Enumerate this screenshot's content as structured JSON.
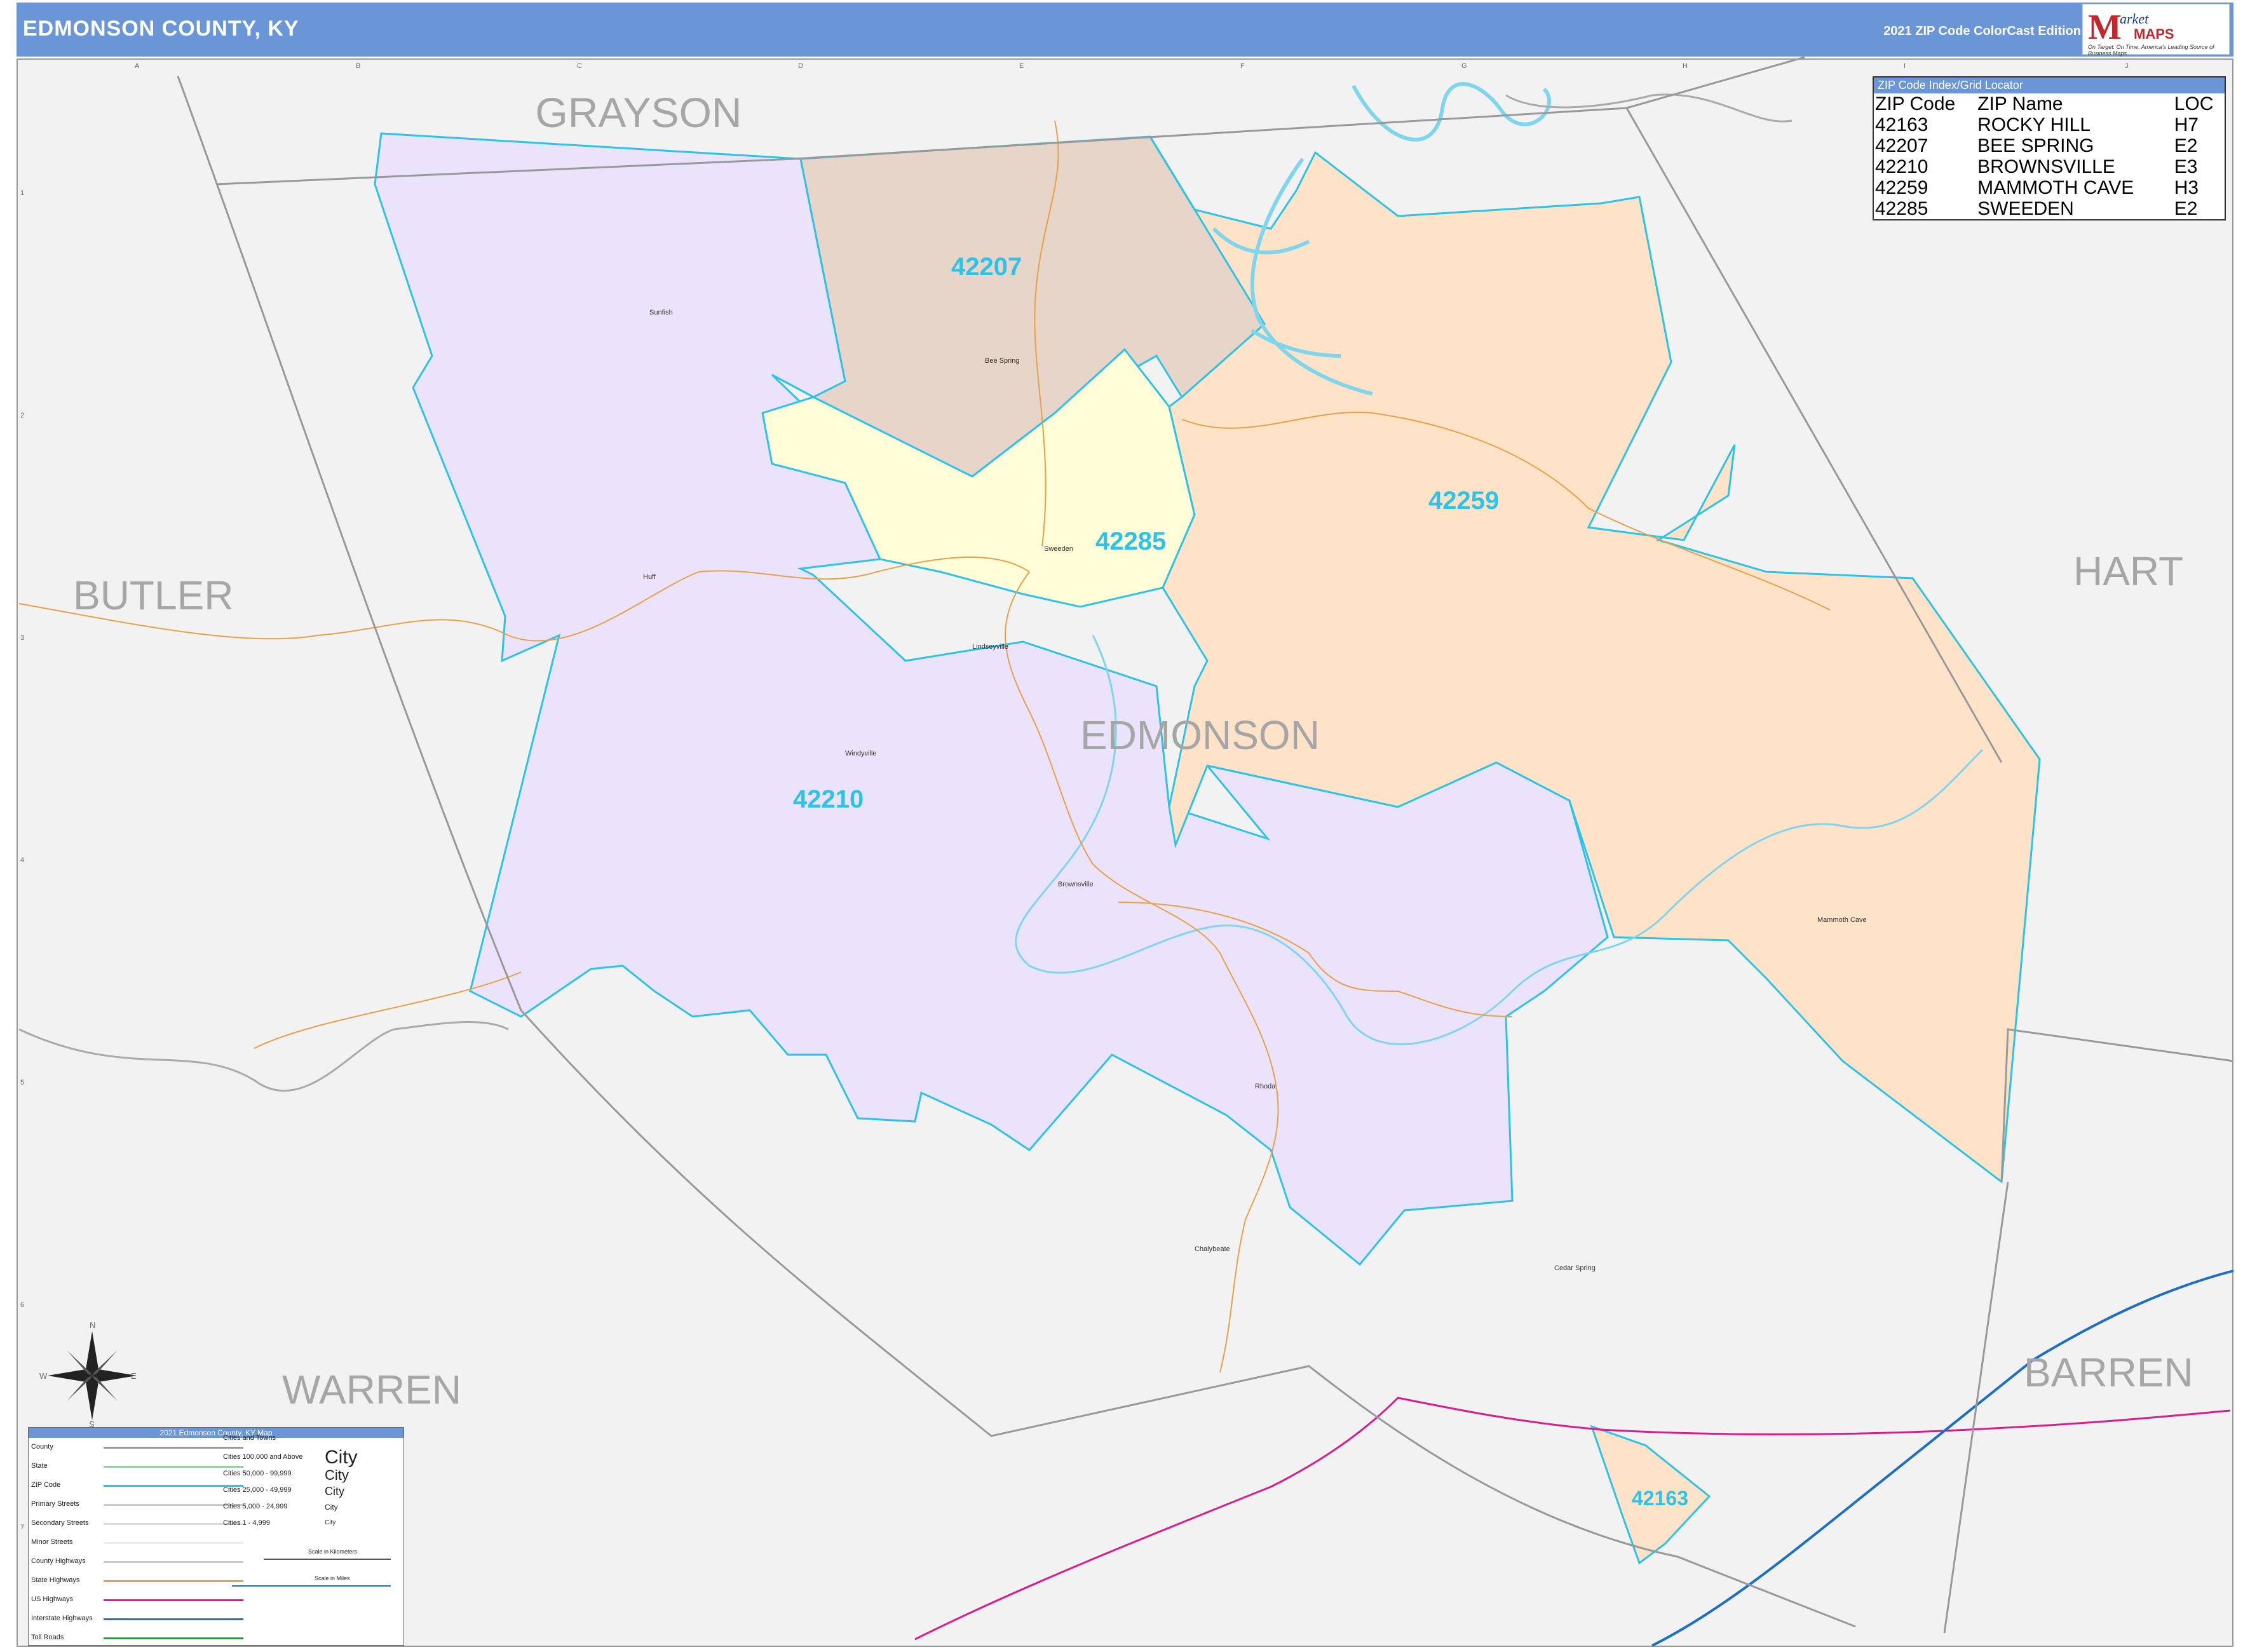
{
  "header": {
    "title": "EDMONSON COUNTY, KY",
    "edition": "2021 ZIP Code ColorCast Edition"
  },
  "logo": {
    "m": "M",
    "arket": "arket",
    "maps": "MAPS",
    "tagline1": "On Target. On Time.",
    "tagline2": "America's Leading Source of Business Maps"
  },
  "colors": {
    "header": "#6a96d8",
    "zip_border": "#2cc3e6",
    "zip_42210": "#ebe3fb",
    "zip_42207": "#e6d5c8",
    "zip_42285": "#fffed8",
    "zip_42259": "#fee3c9",
    "zip_42163": "#fee3c9",
    "water": "#7fd6ec",
    "state_highway": "#e8a04a",
    "us_highway": "#d61e8c",
    "interstate": "#1d6fc4"
  },
  "map": {
    "counties": [
      "GRAYSON",
      "BUTLER",
      "EDMONSON",
      "HART",
      "WARREN",
      "BARREN"
    ],
    "zip_labels": [
      "42207",
      "42285",
      "42259",
      "42210",
      "42163"
    ],
    "towns": [
      "Sunfish",
      "Bee Spring",
      "Sweeden",
      "Huff",
      "Lindseyville",
      "Windyville",
      "Brownsville",
      "Rhoda",
      "Chalybeate",
      "Cedar Spring",
      "Mammoth Cave"
    ],
    "grid_columns": [
      "A",
      "B",
      "C",
      "D",
      "E",
      "F",
      "G",
      "H",
      "I",
      "J"
    ],
    "grid_rows": [
      "1",
      "2",
      "3",
      "4",
      "5",
      "6",
      "7"
    ],
    "compass": [
      "N",
      "E",
      "S",
      "W"
    ]
  },
  "zip_index": {
    "title": "ZIP Code Index/Grid Locator",
    "headers": [
      "ZIP Code",
      "ZIP Name",
      "LOC"
    ],
    "rows": [
      [
        "42163",
        "ROCKY HILL",
        "H7"
      ],
      [
        "42207",
        "BEE SPRING",
        "E2"
      ],
      [
        "42210",
        "BROWNSVILLE",
        "E3"
      ],
      [
        "42259",
        "MAMMOTH CAVE",
        "H3"
      ],
      [
        "42285",
        "SWEEDEN",
        "E2"
      ]
    ]
  },
  "legend": {
    "title": "2021 Edmonson County, KY Map",
    "items": [
      "County",
      "State",
      "ZIP Code",
      "Primary Streets",
      "Secondary Streets",
      "Minor Streets",
      "County Highways",
      "State Highways",
      "US Highways",
      "Interstate Highways",
      "Toll Roads"
    ],
    "cities_title": "Cities and Towns",
    "cities": [
      "Cities 100,000 and Above",
      "Cities 50,000 - 99,999",
      "Cities 25,000 - 49,999",
      "Cities 5,000 - 24,999",
      "Cities 1 - 4,999"
    ],
    "city_samples": [
      "City",
      "City",
      "City",
      "City",
      "City"
    ],
    "scale_km": "Scale in Kilometers",
    "scale_mi": "Scale in Miles"
  }
}
